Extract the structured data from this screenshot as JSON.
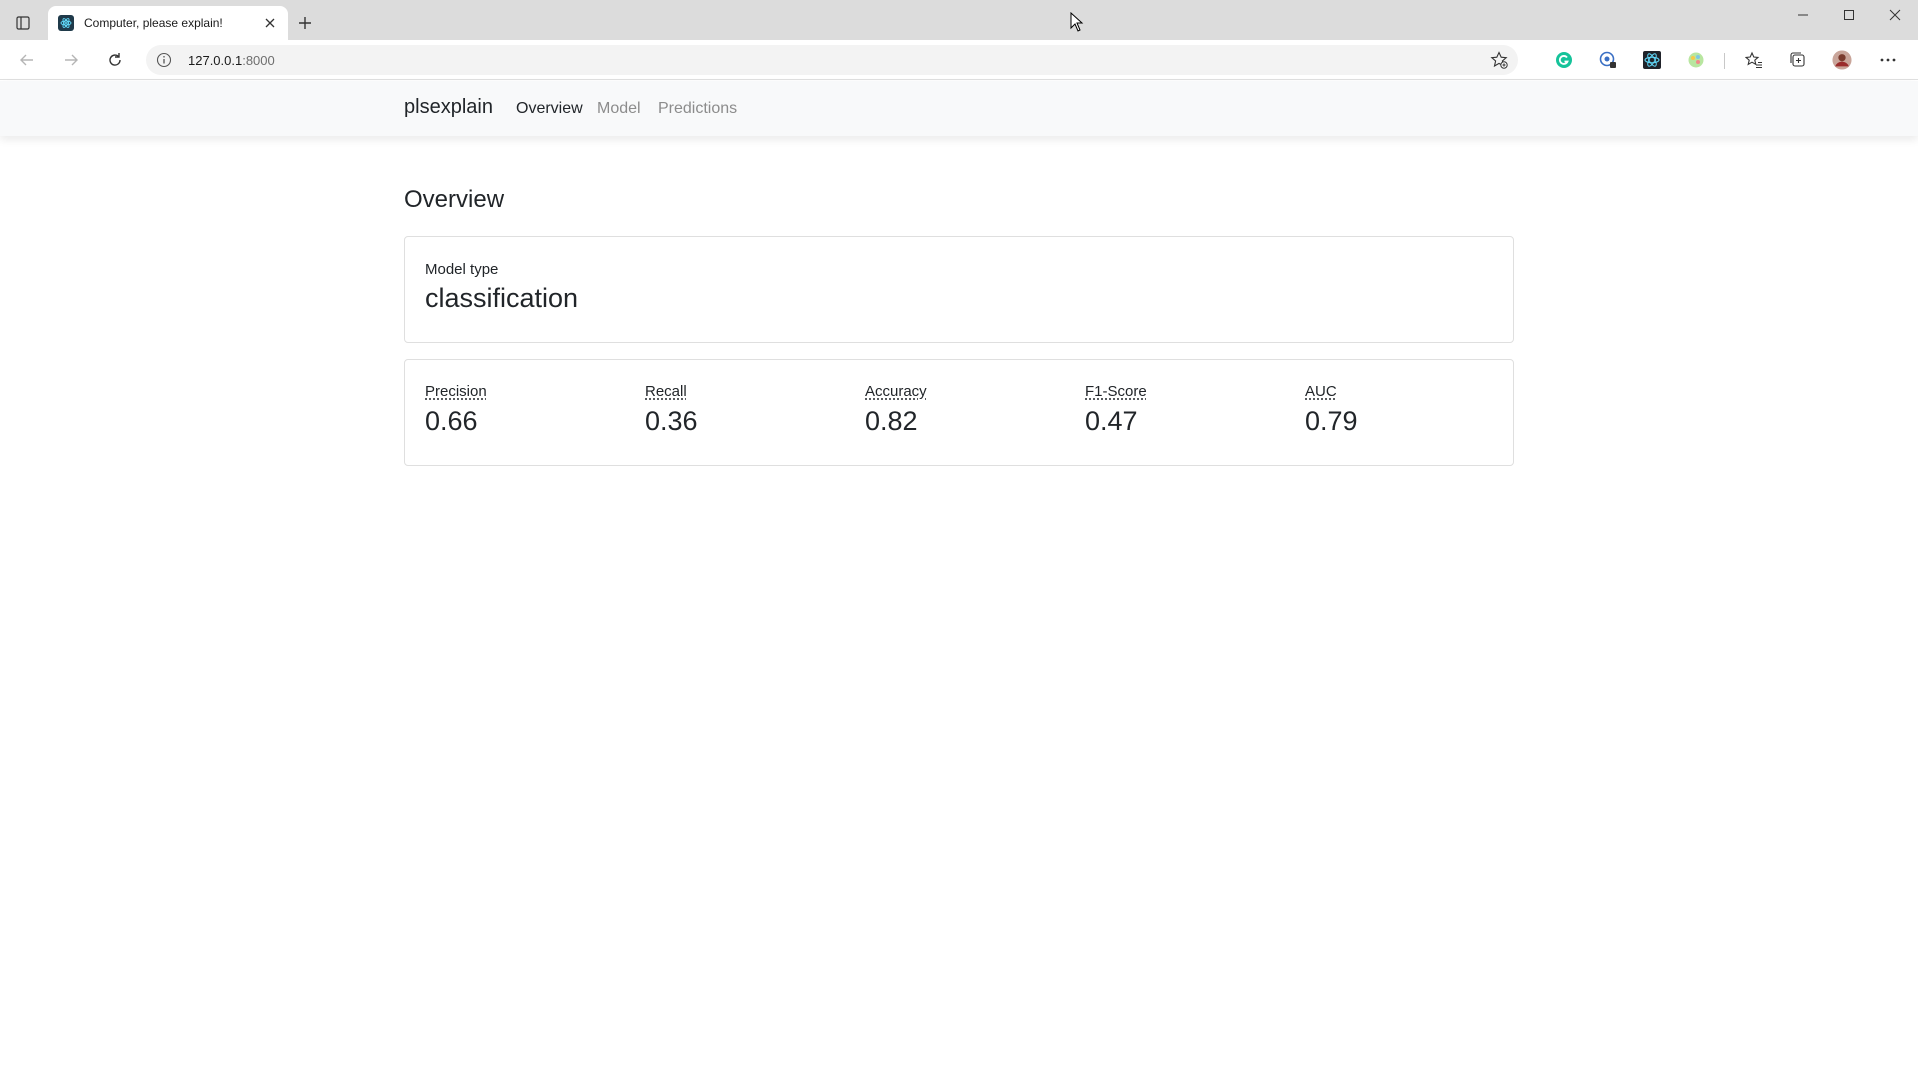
{
  "browser": {
    "tab_title": "Computer, please explain!",
    "url_host": "127.0.0.1",
    "url_port": ":8000"
  },
  "navbar": {
    "brand": "plsexplain",
    "links": [
      {
        "label": "Overview",
        "active": true
      },
      {
        "label": "Model",
        "active": false
      },
      {
        "label": "Predictions",
        "active": false
      }
    ]
  },
  "page": {
    "title": "Overview",
    "model_type_label": "Model type",
    "model_type_value": "classification",
    "metrics": [
      {
        "label": "Precision",
        "value": "0.66"
      },
      {
        "label": "Recall",
        "value": "0.36"
      },
      {
        "label": "Accuracy",
        "value": "0.82"
      },
      {
        "label": "F1-Score",
        "value": "0.47"
      },
      {
        "label": "AUC",
        "value": "0.79"
      }
    ]
  },
  "icons": {
    "favicon": "react-logo-icon",
    "extensions": [
      "grammarly-icon",
      "password-manager-icon",
      "react-devtools-icon",
      "color-picker-icon"
    ],
    "toolbar": [
      "favorites-icon",
      "collections-icon",
      "profile-avatar",
      "more-icon"
    ]
  },
  "colors": {
    "navbar_bg": "#f8f9fa",
    "text": "#212529",
    "muted_link": "#8c8c8c",
    "grammarly": "#15c39a"
  }
}
